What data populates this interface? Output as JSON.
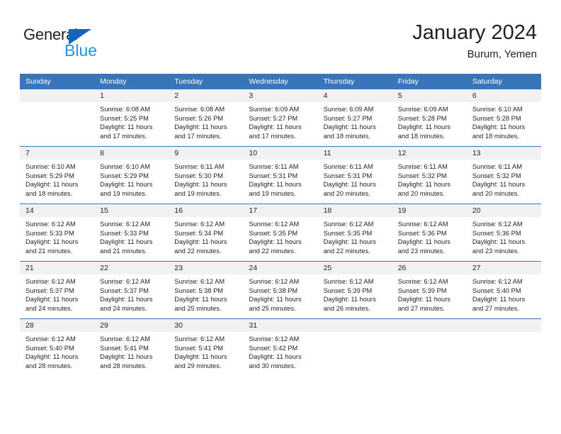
{
  "brand": {
    "name_top": "General",
    "name_bottom": "Blue",
    "triangle_color": "#1565c0",
    "bottom_color": "#2196d6"
  },
  "header": {
    "title": "January 2024",
    "subtitle": "Burum, Yemen"
  },
  "theme": {
    "header_row_bg": "#3876b9",
    "daynum_bg": "#f1f1f1",
    "text": "#231f20",
    "page_bg": "#ffffff"
  },
  "weekdays": [
    "Sunday",
    "Monday",
    "Tuesday",
    "Wednesday",
    "Thursday",
    "Friday",
    "Saturday"
  ],
  "weeks": [
    [
      {
        "day": "",
        "blank": true,
        "sunrise": "",
        "sunset": "",
        "daylight_line1": "",
        "daylight_line2": ""
      },
      {
        "day": "1",
        "sunrise": "Sunrise: 6:08 AM",
        "sunset": "Sunset: 5:25 PM",
        "daylight_line1": "Daylight: 11 hours",
        "daylight_line2": "and 17 minutes."
      },
      {
        "day": "2",
        "sunrise": "Sunrise: 6:08 AM",
        "sunset": "Sunset: 5:26 PM",
        "daylight_line1": "Daylight: 11 hours",
        "daylight_line2": "and 17 minutes."
      },
      {
        "day": "3",
        "sunrise": "Sunrise: 6:09 AM",
        "sunset": "Sunset: 5:27 PM",
        "daylight_line1": "Daylight: 11 hours",
        "daylight_line2": "and 17 minutes."
      },
      {
        "day": "4",
        "sunrise": "Sunrise: 6:09 AM",
        "sunset": "Sunset: 5:27 PM",
        "daylight_line1": "Daylight: 11 hours",
        "daylight_line2": "and 18 minutes."
      },
      {
        "day": "5",
        "sunrise": "Sunrise: 6:09 AM",
        "sunset": "Sunset: 5:28 PM",
        "daylight_line1": "Daylight: 11 hours",
        "daylight_line2": "and 18 minutes."
      },
      {
        "day": "6",
        "sunrise": "Sunrise: 6:10 AM",
        "sunset": "Sunset: 5:28 PM",
        "daylight_line1": "Daylight: 11 hours",
        "daylight_line2": "and 18 minutes."
      }
    ],
    [
      {
        "day": "7",
        "sunrise": "Sunrise: 6:10 AM",
        "sunset": "Sunset: 5:29 PM",
        "daylight_line1": "Daylight: 11 hours",
        "daylight_line2": "and 18 minutes."
      },
      {
        "day": "8",
        "sunrise": "Sunrise: 6:10 AM",
        "sunset": "Sunset: 5:29 PM",
        "daylight_line1": "Daylight: 11 hours",
        "daylight_line2": "and 19 minutes."
      },
      {
        "day": "9",
        "sunrise": "Sunrise: 6:11 AM",
        "sunset": "Sunset: 5:30 PM",
        "daylight_line1": "Daylight: 11 hours",
        "daylight_line2": "and 19 minutes."
      },
      {
        "day": "10",
        "sunrise": "Sunrise: 6:11 AM",
        "sunset": "Sunset: 5:31 PM",
        "daylight_line1": "Daylight: 11 hours",
        "daylight_line2": "and 19 minutes."
      },
      {
        "day": "11",
        "sunrise": "Sunrise: 6:11 AM",
        "sunset": "Sunset: 5:31 PM",
        "daylight_line1": "Daylight: 11 hours",
        "daylight_line2": "and 20 minutes."
      },
      {
        "day": "12",
        "sunrise": "Sunrise: 6:11 AM",
        "sunset": "Sunset: 5:32 PM",
        "daylight_line1": "Daylight: 11 hours",
        "daylight_line2": "and 20 minutes."
      },
      {
        "day": "13",
        "sunrise": "Sunrise: 6:11 AM",
        "sunset": "Sunset: 5:32 PM",
        "daylight_line1": "Daylight: 11 hours",
        "daylight_line2": "and 20 minutes."
      }
    ],
    [
      {
        "day": "14",
        "sunrise": "Sunrise: 6:12 AM",
        "sunset": "Sunset: 5:33 PM",
        "daylight_line1": "Daylight: 11 hours",
        "daylight_line2": "and 21 minutes."
      },
      {
        "day": "15",
        "sunrise": "Sunrise: 6:12 AM",
        "sunset": "Sunset: 5:33 PM",
        "daylight_line1": "Daylight: 11 hours",
        "daylight_line2": "and 21 minutes."
      },
      {
        "day": "16",
        "sunrise": "Sunrise: 6:12 AM",
        "sunset": "Sunset: 5:34 PM",
        "daylight_line1": "Daylight: 11 hours",
        "daylight_line2": "and 22 minutes."
      },
      {
        "day": "17",
        "sunrise": "Sunrise: 6:12 AM",
        "sunset": "Sunset: 5:35 PM",
        "daylight_line1": "Daylight: 11 hours",
        "daylight_line2": "and 22 minutes."
      },
      {
        "day": "18",
        "sunrise": "Sunrise: 6:12 AM",
        "sunset": "Sunset: 5:35 PM",
        "daylight_line1": "Daylight: 11 hours",
        "daylight_line2": "and 22 minutes."
      },
      {
        "day": "19",
        "sunrise": "Sunrise: 6:12 AM",
        "sunset": "Sunset: 5:36 PM",
        "daylight_line1": "Daylight: 11 hours",
        "daylight_line2": "and 23 minutes."
      },
      {
        "day": "20",
        "sunrise": "Sunrise: 6:12 AM",
        "sunset": "Sunset: 5:36 PM",
        "daylight_line1": "Daylight: 11 hours",
        "daylight_line2": "and 23 minutes."
      }
    ],
    [
      {
        "day": "21",
        "sunrise": "Sunrise: 6:12 AM",
        "sunset": "Sunset: 5:37 PM",
        "daylight_line1": "Daylight: 11 hours",
        "daylight_line2": "and 24 minutes."
      },
      {
        "day": "22",
        "sunrise": "Sunrise: 6:12 AM",
        "sunset": "Sunset: 5:37 PM",
        "daylight_line1": "Daylight: 11 hours",
        "daylight_line2": "and 24 minutes."
      },
      {
        "day": "23",
        "sunrise": "Sunrise: 6:12 AM",
        "sunset": "Sunset: 5:38 PM",
        "daylight_line1": "Daylight: 11 hours",
        "daylight_line2": "and 25 minutes."
      },
      {
        "day": "24",
        "sunrise": "Sunrise: 6:12 AM",
        "sunset": "Sunset: 5:38 PM",
        "daylight_line1": "Daylight: 11 hours",
        "daylight_line2": "and 25 minutes."
      },
      {
        "day": "25",
        "sunrise": "Sunrise: 6:12 AM",
        "sunset": "Sunset: 5:39 PM",
        "daylight_line1": "Daylight: 11 hours",
        "daylight_line2": "and 26 minutes."
      },
      {
        "day": "26",
        "sunrise": "Sunrise: 6:12 AM",
        "sunset": "Sunset: 5:39 PM",
        "daylight_line1": "Daylight: 11 hours",
        "daylight_line2": "and 27 minutes."
      },
      {
        "day": "27",
        "sunrise": "Sunrise: 6:12 AM",
        "sunset": "Sunset: 5:40 PM",
        "daylight_line1": "Daylight: 11 hours",
        "daylight_line2": "and 27 minutes."
      }
    ],
    [
      {
        "day": "28",
        "sunrise": "Sunrise: 6:12 AM",
        "sunset": "Sunset: 5:40 PM",
        "daylight_line1": "Daylight: 11 hours",
        "daylight_line2": "and 28 minutes."
      },
      {
        "day": "29",
        "sunrise": "Sunrise: 6:12 AM",
        "sunset": "Sunset: 5:41 PM",
        "daylight_line1": "Daylight: 11 hours",
        "daylight_line2": "and 28 minutes."
      },
      {
        "day": "30",
        "sunrise": "Sunrise: 6:12 AM",
        "sunset": "Sunset: 5:41 PM",
        "daylight_line1": "Daylight: 11 hours",
        "daylight_line2": "and 29 minutes."
      },
      {
        "day": "31",
        "sunrise": "Sunrise: 6:12 AM",
        "sunset": "Sunset: 5:42 PM",
        "daylight_line1": "Daylight: 11 hours",
        "daylight_line2": "and 30 minutes."
      },
      {
        "day": "",
        "blank": true,
        "sunrise": "",
        "sunset": "",
        "daylight_line1": "",
        "daylight_line2": ""
      },
      {
        "day": "",
        "blank": true,
        "sunrise": "",
        "sunset": "",
        "daylight_line1": "",
        "daylight_line2": ""
      },
      {
        "day": "",
        "blank": true,
        "sunrise": "",
        "sunset": "",
        "daylight_line1": "",
        "daylight_line2": ""
      }
    ]
  ]
}
